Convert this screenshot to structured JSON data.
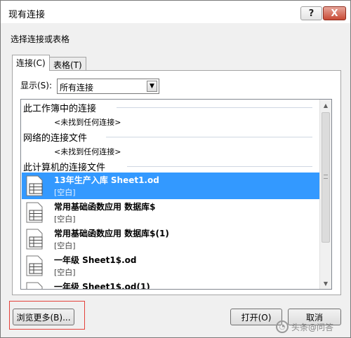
{
  "window": {
    "title": "现有连接",
    "help_label": "?",
    "close_label": "X"
  },
  "subtitle": "选择连接或表格",
  "tabs": [
    {
      "label": "连接(C)",
      "selected": true
    },
    {
      "label": "表格(T)",
      "selected": false
    }
  ],
  "filter": {
    "label": "显示(S):",
    "value": "所有连接"
  },
  "list": {
    "sections": [
      {
        "header": "此工作簿中的连接",
        "empty_text": "<未找到任何连接>"
      },
      {
        "header": "网络的连接文件",
        "empty_text": "<未找到任何连接>"
      },
      {
        "header": "此计算机的连接文件"
      }
    ],
    "items": [
      {
        "name": "13年生产入库 Sheet1.od",
        "description": "[空白]",
        "selected": true
      },
      {
        "name": "常用基础函数应用 数据库$",
        "description": "[空白]",
        "selected": false
      },
      {
        "name": "常用基础函数应用 数据库$(1)",
        "description": "[空白]",
        "selected": false
      },
      {
        "name": "一年级 Sheet1$.od",
        "description": "[空白]",
        "selected": false
      },
      {
        "name": "一年级 Sheet1$.od(1)",
        "description": "",
        "selected": false
      }
    ]
  },
  "buttons": {
    "browse": "浏览更多(B)...",
    "open": "打开(O)",
    "cancel": "取消"
  },
  "watermark": "头条@问答",
  "colors": {
    "selection": "#3399ff",
    "highlight_box": "#e4413a",
    "close_button": "#c84a35"
  }
}
